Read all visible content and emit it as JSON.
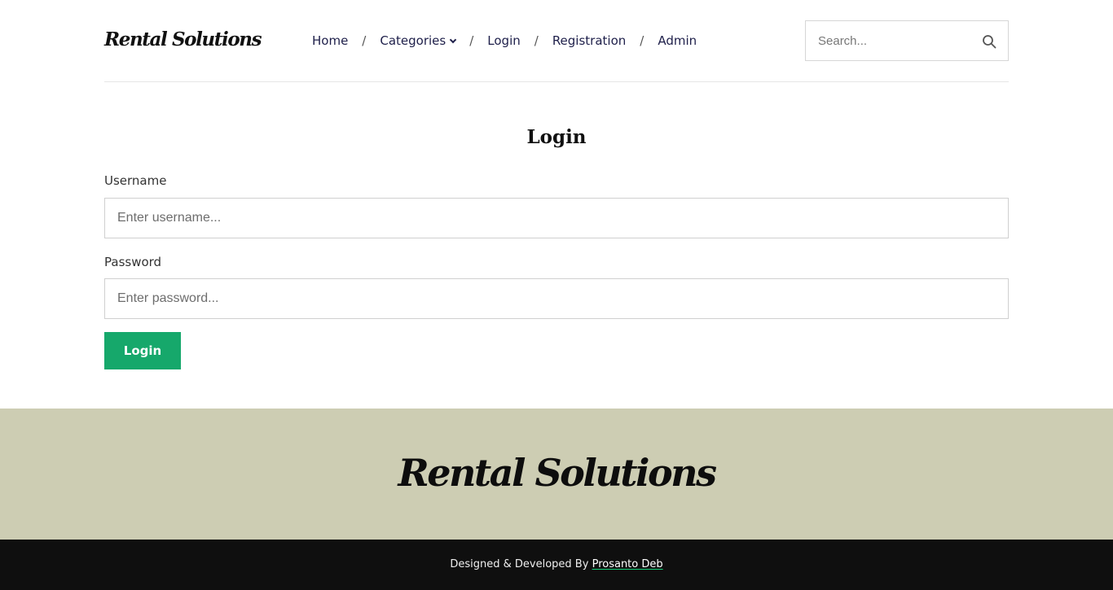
{
  "brand": "Rental Solutions",
  "nav": {
    "home": "Home",
    "categories": "Categories",
    "login": "Login",
    "registration": "Registration",
    "admin": "Admin",
    "separator": "/"
  },
  "search": {
    "placeholder": "Search..."
  },
  "page": {
    "title": "Login"
  },
  "form": {
    "username_label": "Username",
    "username_placeholder": "Enter username...",
    "password_label": "Password",
    "password_placeholder": "Enter password...",
    "submit_label": "Login"
  },
  "footer": {
    "brand": "Rental Solutions",
    "credit_prefix": "Designed & Developed By",
    "credit_name": "Prosanto Deb"
  },
  "colors": {
    "accent": "#16a86b",
    "footer_top_bg": "#cdcdb3",
    "footer_bottom_bg": "#0f0f0f",
    "nav_text": "#1e1f4a"
  },
  "icons": {
    "search": "search-icon",
    "dropdown": "chevron-down-icon"
  }
}
